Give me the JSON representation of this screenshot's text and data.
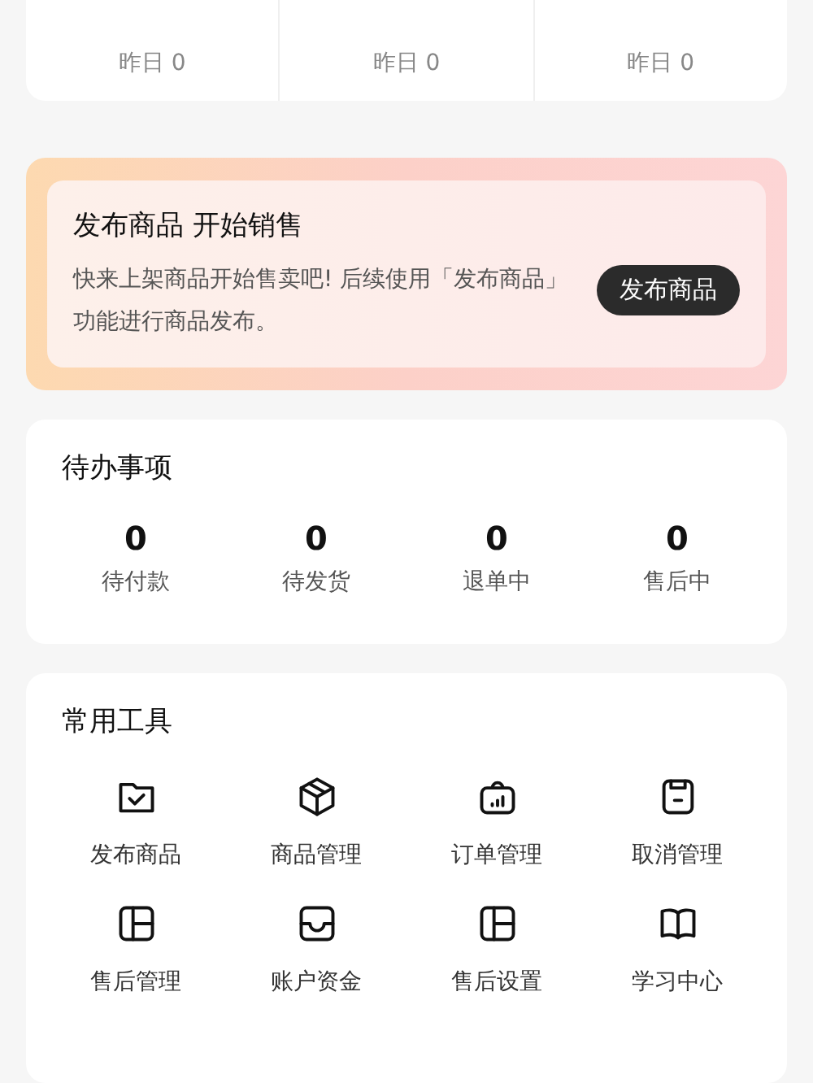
{
  "stats": [
    {
      "yesterday": "昨日 0"
    },
    {
      "yesterday": "昨日 0"
    },
    {
      "yesterday": "昨日 0"
    }
  ],
  "banner": {
    "title": "发布商品 开始销售",
    "description": "快来上架商品开始售卖吧! 后续使用「发布商品」功能进行商品发布。",
    "button": "发布商品"
  },
  "todo": {
    "title": "待办事项",
    "items": [
      {
        "count": "0",
        "label": "待付款"
      },
      {
        "count": "0",
        "label": "待发货"
      },
      {
        "count": "0",
        "label": "退单中"
      },
      {
        "count": "0",
        "label": "售后中"
      }
    ]
  },
  "tools": {
    "title": "常用工具",
    "items": [
      {
        "kind": "folder-check",
        "label": "发布商品"
      },
      {
        "kind": "box",
        "label": "商品管理"
      },
      {
        "kind": "bag-chart",
        "label": "订单管理"
      },
      {
        "kind": "clipboard-minus",
        "label": "取消管理"
      },
      {
        "kind": "layout",
        "label": "售后管理"
      },
      {
        "kind": "tray",
        "label": "账户资金"
      },
      {
        "kind": "layout",
        "label": "售后设置"
      },
      {
        "kind": "book",
        "label": "学习中心"
      }
    ]
  }
}
